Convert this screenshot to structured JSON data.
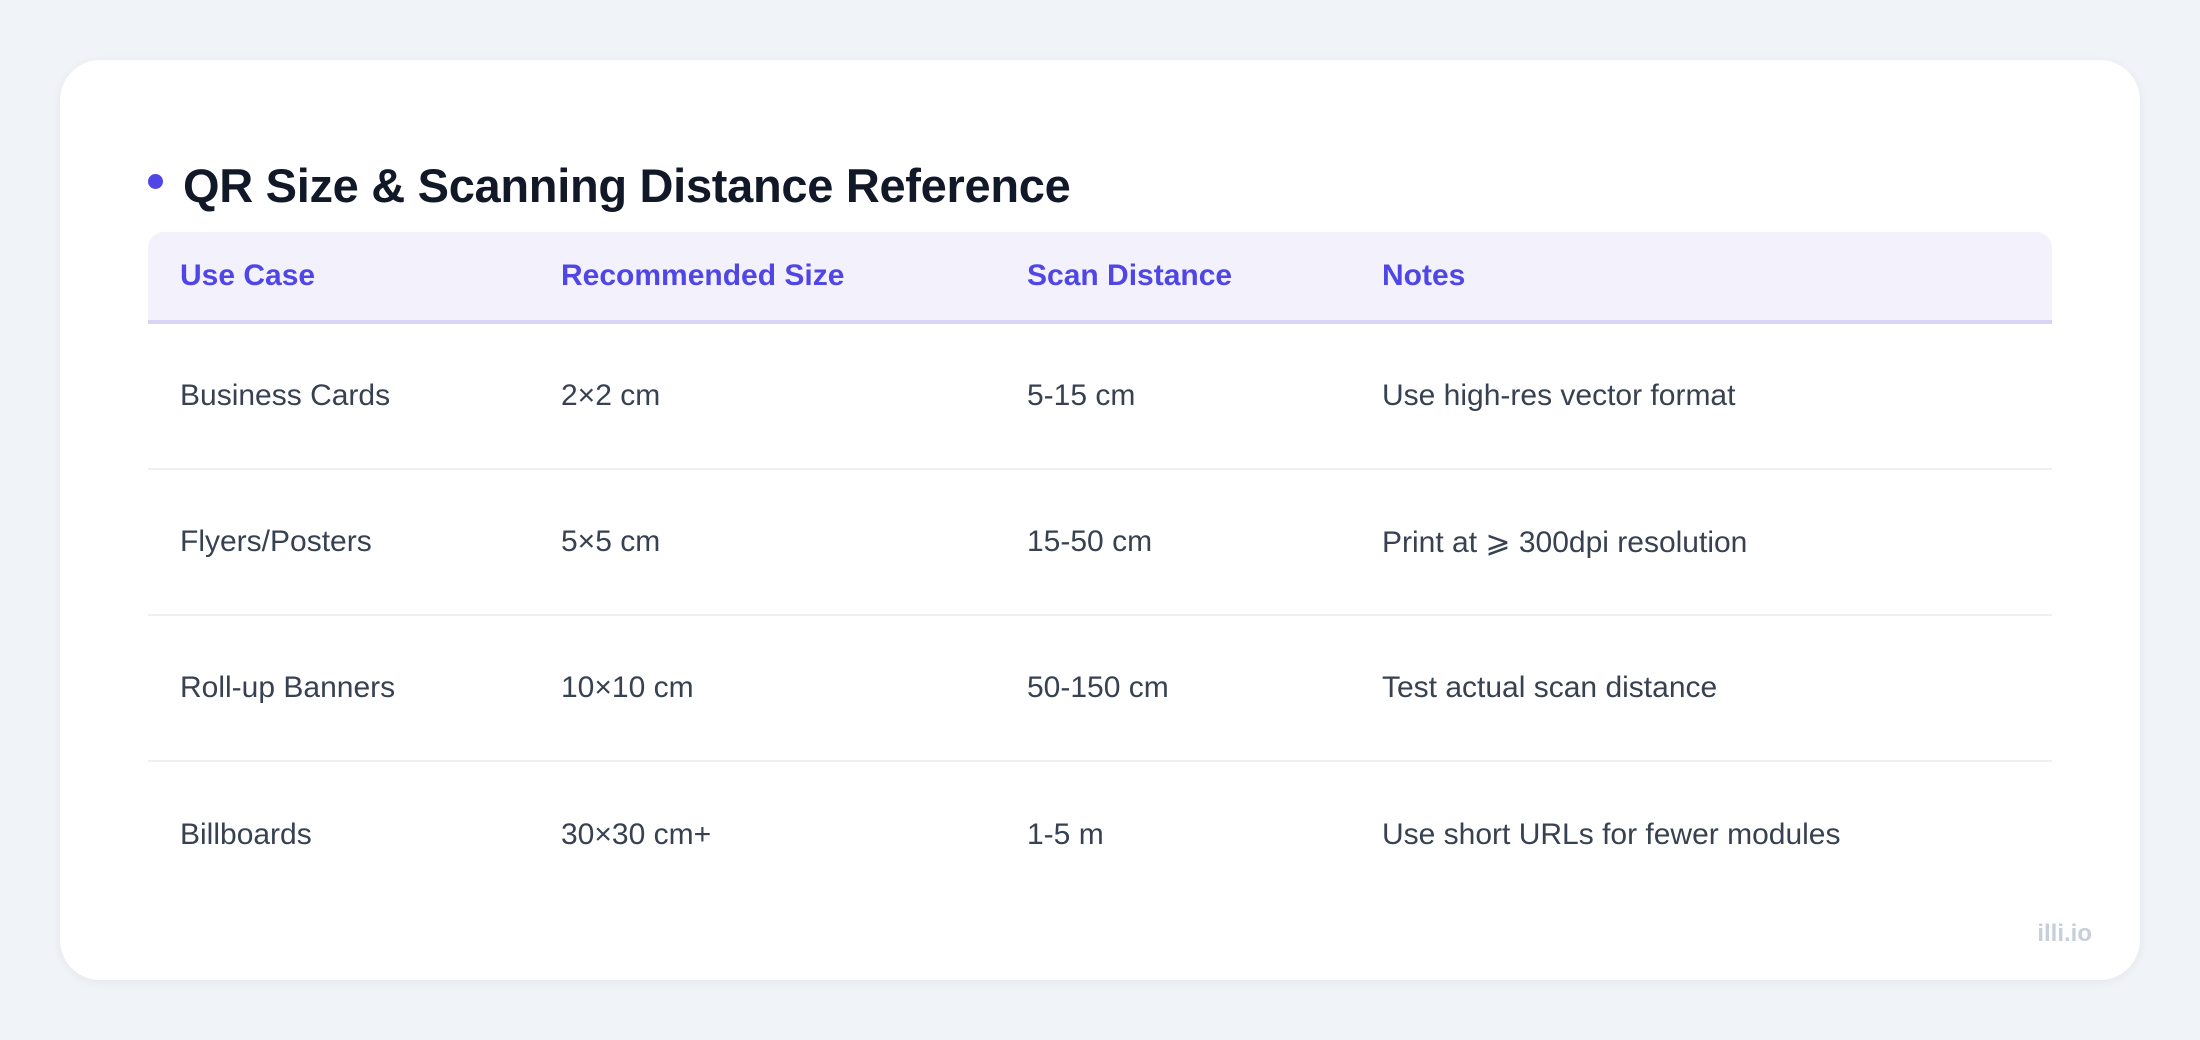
{
  "title": "QR Size & Scanning Distance Reference",
  "columns": [
    "Use Case",
    "Recommended Size",
    "Scan Distance",
    "Notes"
  ],
  "rows": [
    [
      "Business Cards",
      "2×2 cm",
      "5-15 cm",
      "Use high-res vector format"
    ],
    [
      "Flyers/Posters",
      "5×5 cm",
      "15-50 cm",
      "Print at ⩾ 300dpi resolution"
    ],
    [
      "Roll-up Banners",
      "10×10 cm",
      "50-150 cm",
      "Test actual scan distance"
    ],
    [
      "Billboards",
      "30×30 cm+",
      "1-5 m",
      "Use short URLs for fewer modules"
    ]
  ],
  "watermark": "illi.io",
  "colors": {
    "accent": "#4f46e5",
    "header_bg": "#f2f1fc",
    "page_bg": "#f0f3f7"
  }
}
